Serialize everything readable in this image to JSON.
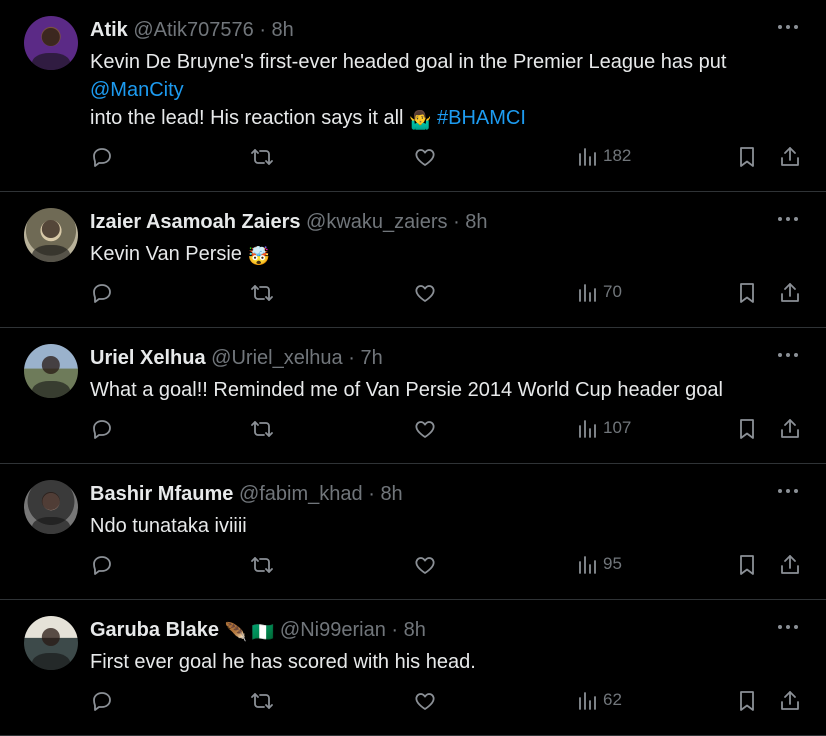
{
  "tweets": [
    {
      "name": "Atik",
      "handle": "@Atik707576",
      "time": "8h",
      "text_parts": [
        "Kevin De Bruyne's first-ever headed goal in the Premier League has put ",
        "@ManCity",
        "into the lead!   His reaction says it all ",
        "🤷‍♂️",
        " #BHAMCI"
      ],
      "views": "182"
    },
    {
      "name": "Izaier Asamoah Zaiers",
      "handle": "@kwaku_zaiers",
      "time": "8h",
      "text_parts": [
        "Kevin Van Persie  ",
        "🤯"
      ],
      "views": "70"
    },
    {
      "name": "Uriel Xelhua",
      "handle": "@Uriel_xelhua",
      "time": "7h",
      "text_parts": [
        "What a goal!! Reminded me of Van Persie 2014 World Cup header goal"
      ],
      "views": "107"
    },
    {
      "name": "Bashir Mfaume",
      "handle": "@fabim_khad",
      "time": "8h",
      "text_parts": [
        "Ndo tunataka iviiii"
      ],
      "views": "95"
    },
    {
      "name": "Garuba Blake",
      "name_emojis": "🪶 🇳🇬",
      "handle": "@Ni99erian",
      "time": "8h",
      "text_parts": [
        "First ever goal he has scored with his head."
      ],
      "views": "62"
    }
  ],
  "separator": "·",
  "colors": {
    "link": "#1d9bf0",
    "muted": "#71767b",
    "text": "#e7e9ea",
    "border": "#2f3336"
  },
  "icons": [
    "reply-icon",
    "retweet-icon",
    "like-icon",
    "views-icon",
    "bookmark-icon",
    "share-icon",
    "more-icon"
  ]
}
